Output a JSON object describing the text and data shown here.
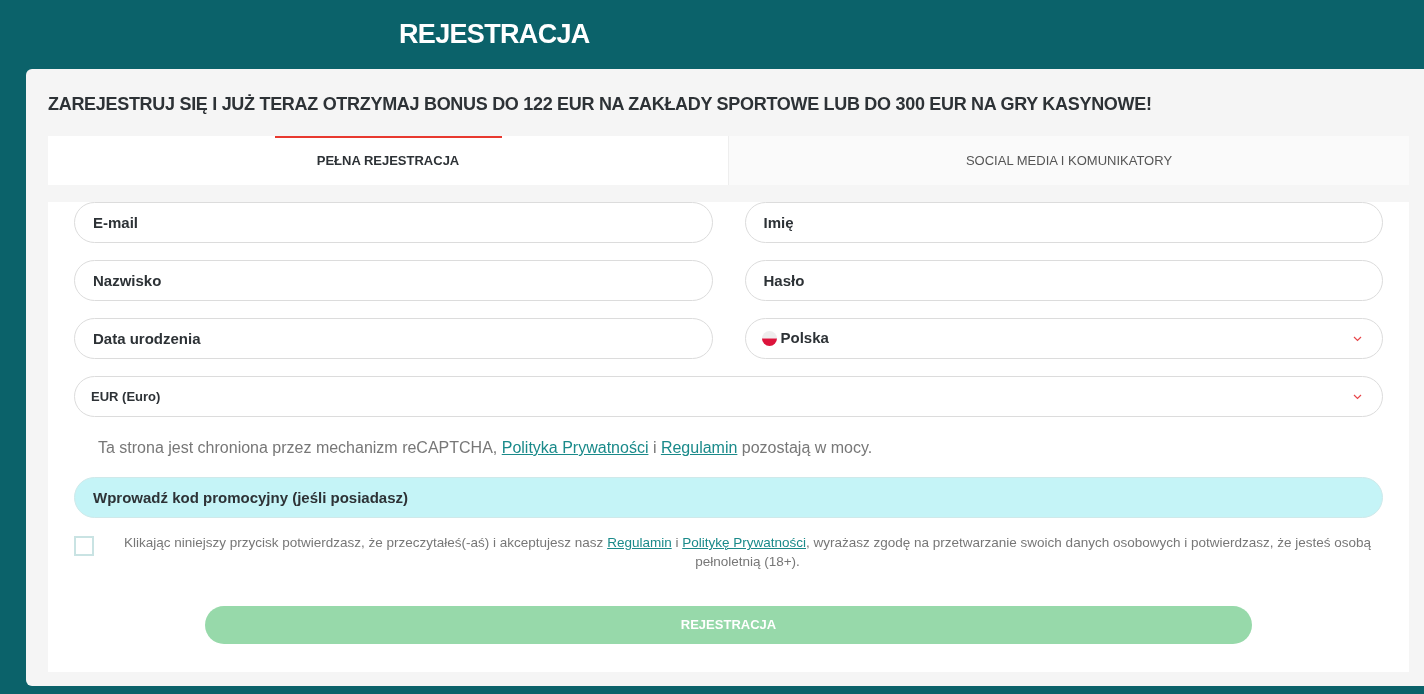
{
  "page_title": "REJESTRACJA",
  "headline": "ZAREJESTRUJ SIĘ I JUŻ TERAZ OTRZYMAJ BONUS DO 122 EUR NA ZAKŁADY SPORTOWE LUB DO 300 EUR NA GRY KASYNOWE!",
  "tabs": [
    {
      "label": "PEŁNA REJESTRACJA",
      "selected": true
    },
    {
      "label": "SOCIAL MEDIA I KOMUNIKATORY",
      "selected": false
    }
  ],
  "fields": [
    {
      "kind": "input",
      "placeholder": "E-mail"
    },
    {
      "kind": "input",
      "placeholder": "Imię"
    },
    {
      "kind": "input",
      "placeholder": "Nazwisko"
    },
    {
      "kind": "input",
      "placeholder": "Hasło"
    },
    {
      "kind": "input",
      "placeholder": "Data urodzenia"
    },
    {
      "kind": "select",
      "value": "Polska",
      "flag": true
    },
    {
      "kind": "select",
      "value": "EUR (Euro)",
      "flag": false,
      "wide": true
    }
  ],
  "recaptcha_notice": [
    {
      "kind": "text",
      "text": "Ta strona jest chroniona przez mechanizm reCAPTCHA, "
    },
    {
      "kind": "link",
      "text": "Polityka Prywatności"
    },
    {
      "kind": "text",
      "text": " i "
    },
    {
      "kind": "link",
      "text": "Regulamin"
    },
    {
      "kind": "text",
      "text": " pozostają w mocy."
    }
  ],
  "promo_code": {
    "placeholder": "Wprowadź kod promocyjny (jeśli posiadasz)"
  },
  "consent": {
    "checked": false,
    "parts": [
      {
        "kind": "text",
        "text": "Klikając niniejszy przycisk potwierdzasz, że przeczytałeś(-aś) i akceptujesz nasz "
      },
      {
        "kind": "link",
        "text": "Regulamin"
      },
      {
        "kind": "text",
        "text": " i "
      },
      {
        "kind": "link",
        "text": "Politykę Prywatności"
      },
      {
        "kind": "text",
        "text": ", wyrażasz zgodę na przetwarzanie swoich danych osobowych i potwierdzasz, że jesteś osobą pełnoletnią (18+)."
      }
    ]
  },
  "submit": {
    "label": "REJESTRACJA",
    "disabled": true
  }
}
